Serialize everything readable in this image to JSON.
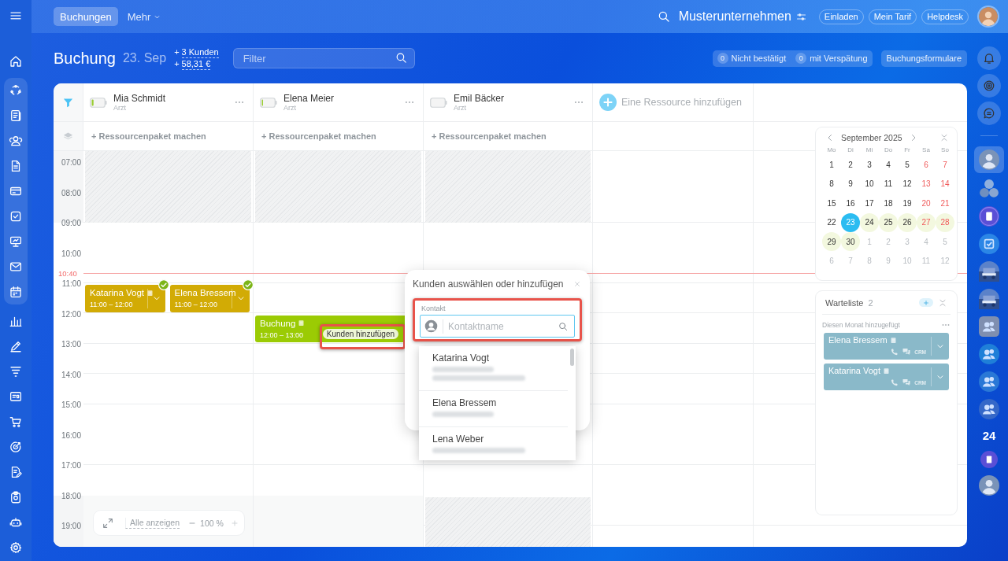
{
  "topbar": {
    "tabs": [
      {
        "label": "Buchungen",
        "selected": true,
        "dropdown": false
      },
      {
        "label": "Mehr",
        "selected": false,
        "dropdown": true
      }
    ],
    "company": "Musterunternehmen",
    "buttons": [
      "Einladen",
      "Mein Tarif",
      "Helpdesk"
    ]
  },
  "header": {
    "title": "Buchung",
    "date": "23. Sep",
    "stats": [
      {
        "sign": "+",
        "value": "3 Kunden"
      },
      {
        "sign": "+",
        "value": "58,31 €"
      }
    ],
    "filter": {
      "placeholder": "Filter"
    },
    "counters": [
      {
        "count": "0",
        "label": "Nicht bestätigt"
      },
      {
        "count": "0",
        "label": "mit Verspätung"
      }
    ],
    "forms_button": "Buchungsformulare"
  },
  "resources": [
    {
      "name": "Mia Schmidt",
      "role": "Arzt",
      "level": 0.15,
      "pack_action": "+ Ressourcenpaket machen",
      "bookings": [
        {
          "client": "Katarina Vogt",
          "time": "11:00 – 12:00",
          "color": "#d2ab05",
          "confirmed": true,
          "note": true,
          "expandable": true
        },
        {
          "client": "Elena Bressem",
          "time": "11:00 – 12:00",
          "color": "#d2ab05",
          "confirmed": true,
          "note": false,
          "expandable": true
        }
      ]
    },
    {
      "name": "Elena Meier",
      "role": "Arzt",
      "level": 0.1,
      "pack_action": "+ Ressourcenpaket machen",
      "bookings": [
        {
          "client": "Buchung",
          "time": "12:00 – 13:00",
          "color": "#9bcb04",
          "confirmed": false,
          "note": true,
          "expandable": false,
          "add_client": "Kunden hinzufügen",
          "add_client_highlighted": true
        }
      ]
    },
    {
      "name": "Emil Bäcker",
      "role": "Arzt",
      "level": 0,
      "pack_action": "+ Ressourcenpaket machen"
    }
  ],
  "add_resource": "Eine Ressource hinzufügen",
  "hours": [
    "07:00",
    "08:00",
    "09:00",
    "10:00",
    "11:00",
    "12:00",
    "13:00",
    "14:00",
    "15:00",
    "16:00",
    "17:00",
    "18:00",
    "19:00"
  ],
  "current_time": "10:40",
  "zoom_control": {
    "show_all": "Alle anzeigen",
    "zoom": "100 %"
  },
  "customer_popup": {
    "title": "Kunden auswählen oder hinzufügen",
    "field_label": "Kontakt",
    "field": {
      "placeholder": "Kontaktname"
    },
    "highlighted": true,
    "suggestions": [
      {
        "name": "Katarina Vogt",
        "phone_hidden": true,
        "email_hidden": true
      },
      {
        "name": "Elena Bressem",
        "phone_hidden": true,
        "email_hidden": false
      },
      {
        "name": "Lena Weber",
        "phone_hidden": false,
        "email_hidden": true
      }
    ]
  },
  "mini_calendar": {
    "month": "September 2025",
    "weekdays": [
      "Mo",
      "Di",
      "Mi",
      "Do",
      "Fr",
      "Sa",
      "So"
    ],
    "weeks": [
      [
        {
          "day": "1",
          "weekend": false,
          "outside": false,
          "selected": false,
          "booked": false
        },
        {
          "day": "2",
          "weekend": false,
          "outside": false,
          "selected": false,
          "booked": false
        },
        {
          "day": "3",
          "weekend": false,
          "outside": false,
          "selected": false,
          "booked": false
        },
        {
          "day": "4",
          "weekend": false,
          "outside": false,
          "selected": false,
          "booked": false
        },
        {
          "day": "5",
          "weekend": false,
          "outside": false,
          "selected": false,
          "booked": false
        },
        {
          "day": "6",
          "weekend": true,
          "outside": false,
          "selected": false,
          "booked": false
        },
        {
          "day": "7",
          "weekend": true,
          "outside": false,
          "selected": false,
          "booked": false
        }
      ],
      [
        {
          "day": "8",
          "weekend": false,
          "outside": false,
          "selected": false,
          "booked": false
        },
        {
          "day": "9",
          "weekend": false,
          "outside": false,
          "selected": false,
          "booked": false
        },
        {
          "day": "10",
          "weekend": false,
          "outside": false,
          "selected": false,
          "booked": false
        },
        {
          "day": "11",
          "weekend": false,
          "outside": false,
          "selected": false,
          "booked": false
        },
        {
          "day": "12",
          "weekend": false,
          "outside": false,
          "selected": false,
          "booked": false
        },
        {
          "day": "13",
          "weekend": true,
          "outside": false,
          "selected": false,
          "booked": false
        },
        {
          "day": "14",
          "weekend": true,
          "outside": false,
          "selected": false,
          "booked": false
        }
      ],
      [
        {
          "day": "15",
          "weekend": false,
          "outside": false,
          "selected": false,
          "booked": false
        },
        {
          "day": "16",
          "weekend": false,
          "outside": false,
          "selected": false,
          "booked": false
        },
        {
          "day": "17",
          "weekend": false,
          "outside": false,
          "selected": false,
          "booked": false
        },
        {
          "day": "18",
          "weekend": false,
          "outside": false,
          "selected": false,
          "booked": false
        },
        {
          "day": "19",
          "weekend": false,
          "outside": false,
          "selected": false,
          "booked": false
        },
        {
          "day": "20",
          "weekend": true,
          "outside": false,
          "selected": false,
          "booked": false
        },
        {
          "day": "21",
          "weekend": true,
          "outside": false,
          "selected": false,
          "booked": false
        }
      ],
      [
        {
          "day": "22",
          "weekend": false,
          "outside": false,
          "selected": false,
          "booked": false
        },
        {
          "day": "23",
          "weekend": false,
          "outside": false,
          "selected": true,
          "booked": false
        },
        {
          "day": "24",
          "weekend": false,
          "outside": false,
          "selected": false,
          "booked": true
        },
        {
          "day": "25",
          "weekend": false,
          "outside": false,
          "selected": false,
          "booked": true
        },
        {
          "day": "26",
          "weekend": false,
          "outside": false,
          "selected": false,
          "booked": true
        },
        {
          "day": "27",
          "weekend": true,
          "outside": false,
          "selected": false,
          "booked": true
        },
        {
          "day": "28",
          "weekend": true,
          "outside": false,
          "selected": false,
          "booked": true
        }
      ],
      [
        {
          "day": "29",
          "weekend": false,
          "outside": false,
          "selected": false,
          "booked": true
        },
        {
          "day": "30",
          "weekend": false,
          "outside": false,
          "selected": false,
          "booked": true
        },
        {
          "day": "1",
          "weekend": false,
          "outside": true,
          "selected": false,
          "booked": false
        },
        {
          "day": "2",
          "weekend": false,
          "outside": true,
          "selected": false,
          "booked": false
        },
        {
          "day": "3",
          "weekend": false,
          "outside": true,
          "selected": false,
          "booked": false
        },
        {
          "day": "4",
          "weekend": false,
          "outside": true,
          "selected": false,
          "booked": false
        },
        {
          "day": "5",
          "weekend": false,
          "outside": true,
          "selected": false,
          "booked": false
        }
      ],
      [
        {
          "day": "6",
          "weekend": false,
          "outside": true,
          "selected": false,
          "booked": false
        },
        {
          "day": "7",
          "weekend": false,
          "outside": true,
          "selected": false,
          "booked": false
        },
        {
          "day": "8",
          "weekend": false,
          "outside": true,
          "selected": false,
          "booked": false
        },
        {
          "day": "9",
          "weekend": false,
          "outside": true,
          "selected": false,
          "booked": false
        },
        {
          "day": "10",
          "weekend": false,
          "outside": true,
          "selected": false,
          "booked": false
        },
        {
          "day": "11",
          "weekend": false,
          "outside": true,
          "selected": false,
          "booked": false
        },
        {
          "day": "12",
          "weekend": false,
          "outside": true,
          "selected": false,
          "booked": false
        }
      ]
    ]
  },
  "waitlist": {
    "title": "Warteliste",
    "count": "2",
    "group": "Diesen Monat hinzugefügt",
    "entries": [
      {
        "name": "Elena Bressem",
        "note": true,
        "crm": "CRM"
      },
      {
        "name": "Katarina Vogt",
        "note": true,
        "crm": "CRM"
      }
    ]
  },
  "rail_badge": "24"
}
